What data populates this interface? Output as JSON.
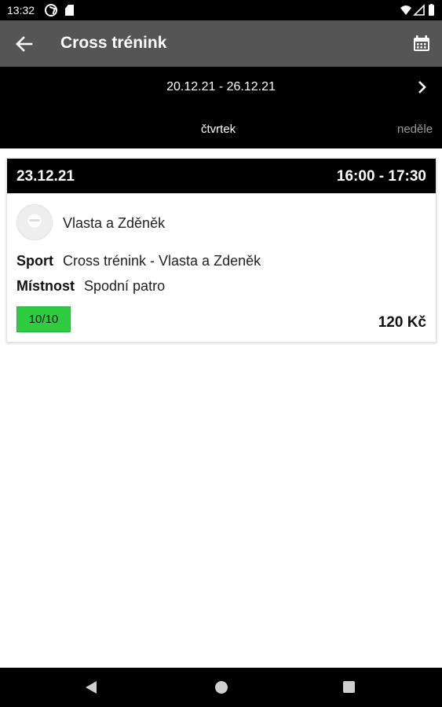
{
  "status_bar": {
    "time": "13:32",
    "icons": [
      "sync-icon",
      "sd-card-icon",
      "wifi-icon",
      "signal-icon",
      "battery-icon"
    ]
  },
  "app_bar": {
    "title": "Cross trénink",
    "back_icon": "arrow-left-icon",
    "calendar_icon": "calendar-icon"
  },
  "week": {
    "range": "20.12.21 - 26.12.21",
    "next_icon": "chevron-right-icon"
  },
  "day_tabs": {
    "active": "čtvrtek",
    "next": "neděle"
  },
  "event": {
    "date": "23.12.21",
    "time": "16:00 - 17:30",
    "trainer": "Vlasta a Zděněk",
    "sport_label": "Sport",
    "sport_value": "Cross trénink - Vlasta a Zdeněk",
    "room_label": "Místnost",
    "room_value": "Spodní patro",
    "capacity": "10/10",
    "price": "120 Kč"
  },
  "colors": {
    "app_bar": "#555555",
    "header_black": "#000000",
    "capacity_green": "#2ecc40",
    "inactive_tab": "#9a9a9a"
  },
  "nav_bar": {
    "icons": [
      "nav-back-icon",
      "nav-home-icon",
      "nav-recents-icon"
    ]
  }
}
